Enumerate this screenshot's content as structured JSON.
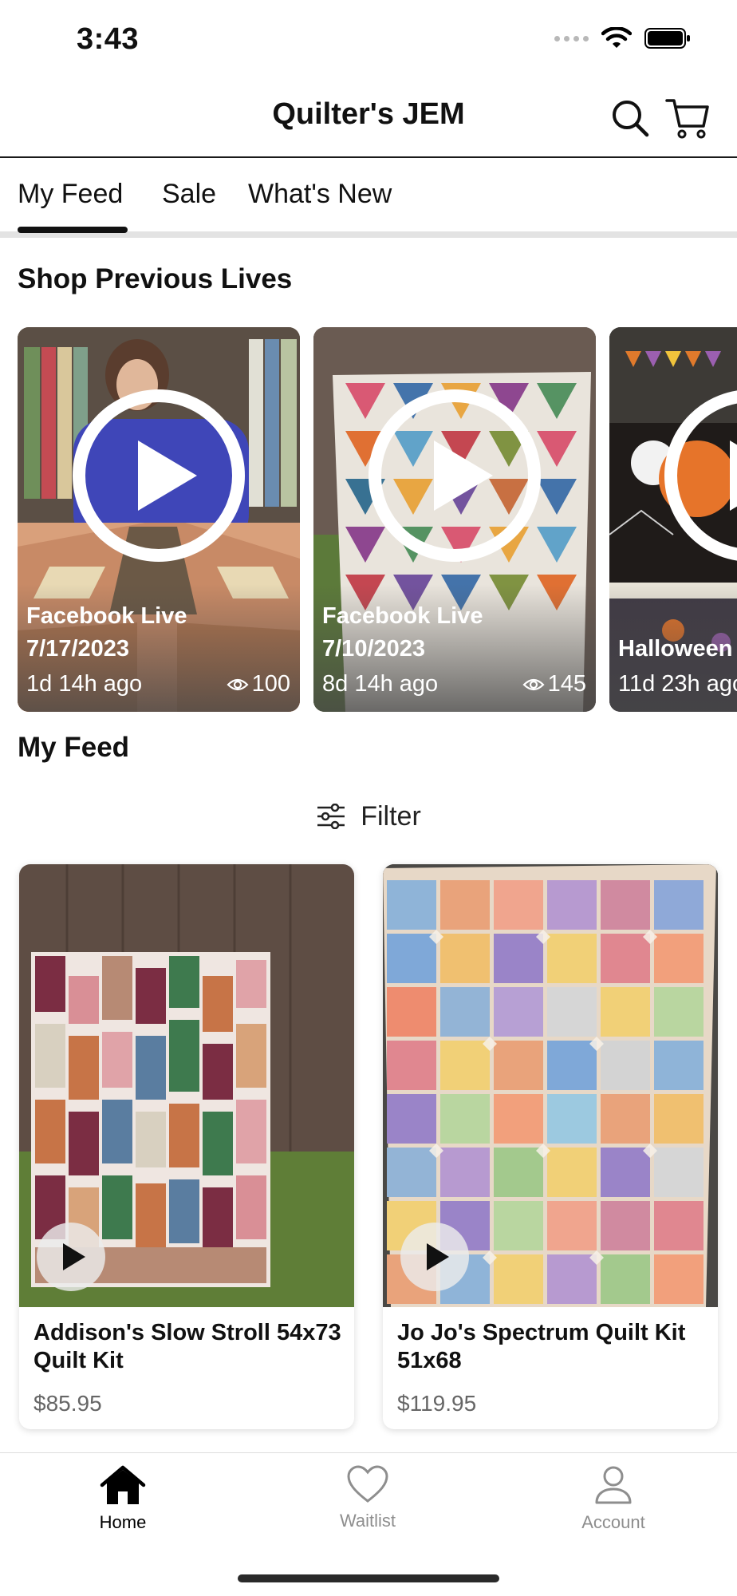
{
  "status_bar": {
    "time": "3:43"
  },
  "header": {
    "title": "Quilter's JEM"
  },
  "tabs": [
    {
      "label": "My Feed",
      "active": true
    },
    {
      "label": "Sale",
      "active": false
    },
    {
      "label": "What's New",
      "active": false
    }
  ],
  "sections": {
    "lives_title": "Shop Previous Lives",
    "feed_title": "My Feed"
  },
  "lives": [
    {
      "title": "Facebook Live",
      "date": "7/17/2023",
      "ago": "1d 14h ago",
      "views": "100"
    },
    {
      "title": "Facebook Live",
      "date": "7/10/2023",
      "ago": "8d 14h ago",
      "views": "145"
    },
    {
      "title": "Halloween",
      "ago": "11d 23h ago"
    }
  ],
  "filter": {
    "label": "Filter"
  },
  "products": [
    {
      "name": "Addison's Slow Stroll 54x73 Quilt Kit",
      "price": "$85.95"
    },
    {
      "name": "Jo Jo's Spectrum Quilt Kit 51x68",
      "price": "$119.95"
    }
  ],
  "bottom_nav": [
    {
      "label": "Home",
      "active": true
    },
    {
      "label": "Waitlist",
      "active": false
    },
    {
      "label": "Account",
      "active": false
    }
  ],
  "colors": {
    "text": "#111111",
    "inactive": "#8e8e8e",
    "divider": "#e3e3e3",
    "price": "#666666"
  },
  "icons": [
    "wifi-icon",
    "battery-icon",
    "search-icon",
    "cart-icon",
    "play-icon",
    "eye-icon",
    "filter-icon",
    "home-icon",
    "heart-icon",
    "person-icon"
  ]
}
